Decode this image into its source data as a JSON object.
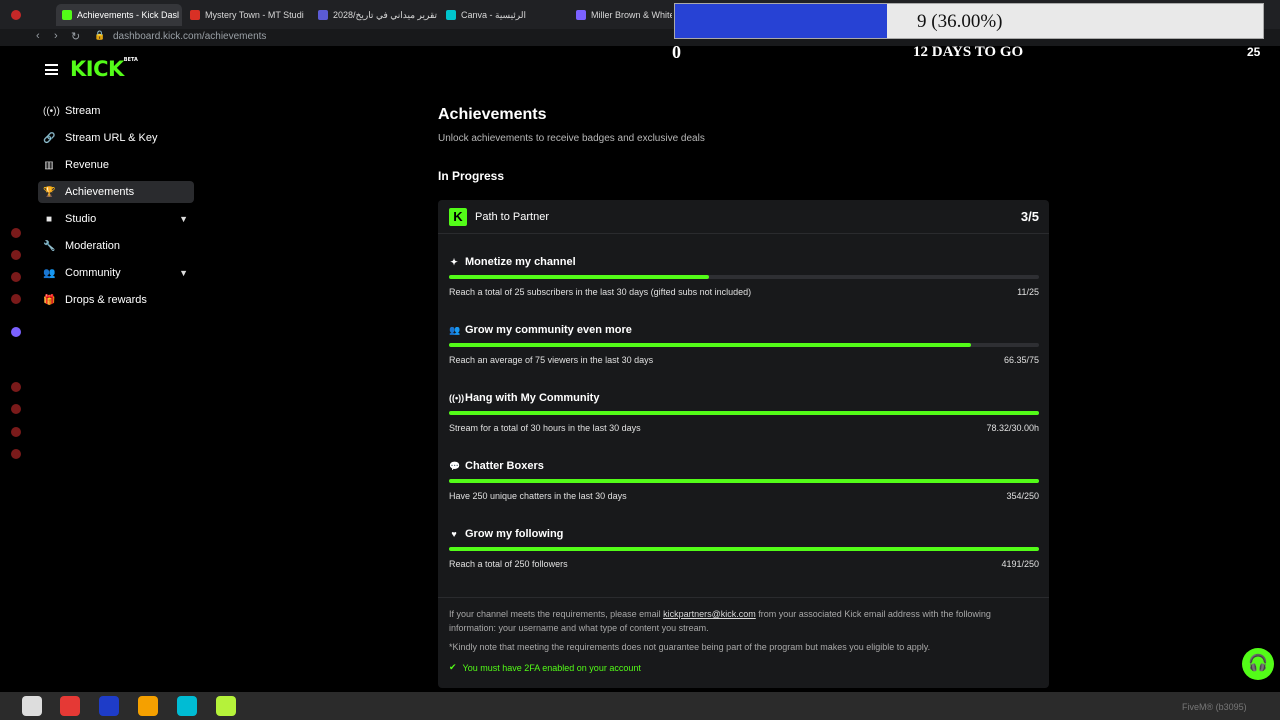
{
  "browser": {
    "tabs": [
      {
        "title": "Achievements - Kick Dasl",
        "color": "#53fc18"
      },
      {
        "title": "Mystery Town - MT Studi",
        "color": "#d93025"
      },
      {
        "title": "2028/تقرير ميداني في تاريخ",
        "color": "#5b5bd6"
      },
      {
        "title": "Canva - الرئيسية",
        "color": "#00c4cc"
      },
      {
        "title": "Miller Brown & White",
        "color": "#7b61ff"
      }
    ],
    "url": "dashboard.kick.com/achievements"
  },
  "overlay": {
    "progress_text": "9 (36.00%)",
    "progress_fraction": 0.36,
    "left_value": "0",
    "days_label": "12 DAYS TO GO",
    "right_value": "25"
  },
  "sidebar": {
    "logo": "KICK",
    "logo_beta": "BETA",
    "items": [
      {
        "label": "Stream",
        "icon": "broadcast-icon",
        "glyph": "((•))"
      },
      {
        "label": "Stream URL & Key",
        "icon": "link-icon",
        "glyph": "🔗"
      },
      {
        "label": "Revenue",
        "icon": "chart-icon",
        "glyph": "▥"
      },
      {
        "label": "Achievements",
        "icon": "trophy-icon",
        "glyph": "🏆"
      },
      {
        "label": "Studio",
        "icon": "video-icon",
        "glyph": "■"
      },
      {
        "label": "Moderation",
        "icon": "wrench-icon",
        "glyph": "🔧"
      },
      {
        "label": "Community",
        "icon": "people-icon",
        "glyph": "👥"
      },
      {
        "label": "Drops & rewards",
        "icon": "gift-icon",
        "glyph": "🎁"
      }
    ]
  },
  "main": {
    "title": "Achievements",
    "subtitle": "Unlock achievements to receive badges and exclusive deals",
    "section": "In Progress",
    "card": {
      "badge": "K",
      "title": "Path to Partner",
      "count": "3/5",
      "achievements": [
        {
          "title": "Monetize my channel",
          "icon": "sparkle-icon",
          "glyph": "✦",
          "desc": "Reach a total of 25 subscribers in the last 30 days (gifted subs not included)",
          "value": "11/25",
          "progress": 0.44
        },
        {
          "title": "Grow my community even more",
          "icon": "community-icon",
          "glyph": "👥",
          "desc": "Reach an average of 75 viewers in the last 30 days",
          "value": "66.35/75",
          "progress": 0.885
        },
        {
          "title": "Hang with My Community",
          "icon": "broadcast-icon",
          "glyph": "((•))",
          "desc": "Stream for a total of 30 hours in the last 30 days",
          "value": "78.32/30.00h",
          "progress": 1.0
        },
        {
          "title": "Chatter Boxers",
          "icon": "chat-icon",
          "glyph": "💬",
          "desc": "Have 250 unique chatters in the last 30 days",
          "value": "354/250",
          "progress": 1.0
        },
        {
          "title": "Grow my following",
          "icon": "heart-icon",
          "glyph": "♥",
          "desc": "Reach a total of 250 followers",
          "value": "4191/250",
          "progress": 1.0
        }
      ],
      "note_before": "If your channel meets the requirements, please email ",
      "note_email": "kickpartners@kick.com",
      "note_after": " from your associated Kick email address with the following information: your username and what type of content you stream.",
      "disclaimer": "*Kindly note that meeting the requirements does not guarantee being part of the program but makes you eligible to apply.",
      "twofa": "You must have 2FA enabled on your account"
    }
  },
  "help_glyph": "🎧",
  "taskbar_text": "FiveM® (b3095)"
}
